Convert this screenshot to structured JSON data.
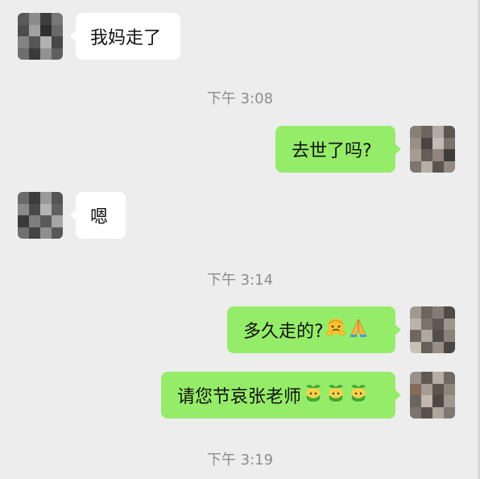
{
  "chat": {
    "messages": [
      {
        "side": "left",
        "text": "我妈走了"
      },
      {
        "side": "right",
        "text": "去世了吗?"
      },
      {
        "side": "left",
        "text": "嗯"
      },
      {
        "side": "right",
        "text": "多久走的?",
        "emojis": [
          "worried-face-emoji",
          "folded-hands-emoji"
        ]
      },
      {
        "side": "right",
        "text": "请您节哀张老师",
        "emojis": [
          "sprout-face-emoji",
          "sprout-face-emoji",
          "sprout-face-emoji"
        ]
      }
    ],
    "timestamps": [
      "下午 3:08",
      "下午 3:14",
      "下午 3:19"
    ]
  },
  "colors": {
    "background": "#ededed",
    "incoming_bubble": "#ffffff",
    "outgoing_bubble": "#95ec69",
    "timestamp_text": "#8c8c8c"
  }
}
